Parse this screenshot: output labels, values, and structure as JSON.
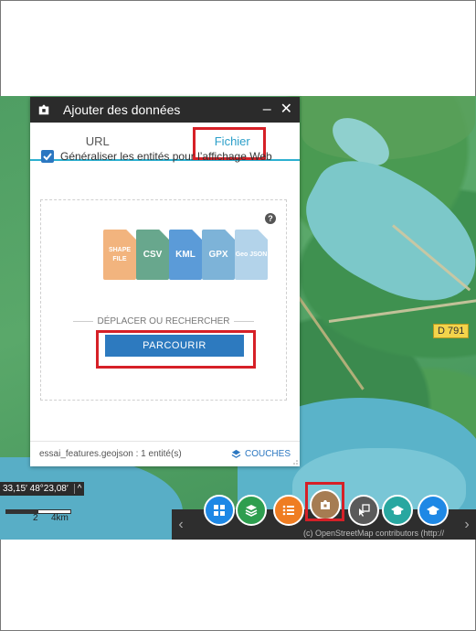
{
  "dialog": {
    "title": "Ajouter des données",
    "minimize_label": "–",
    "close_label": "✕",
    "tabs": [
      {
        "label": "URL",
        "active": false
      },
      {
        "label": "Fichier",
        "active": true
      }
    ],
    "generalize_checkbox": {
      "label": "Généraliser les entités pour l’affichage Web",
      "checked": true
    },
    "help_label": "?",
    "file_types": [
      "SHAPE FILE",
      "CSV",
      "KML",
      "GPX",
      "Geo JSON"
    ],
    "drop_hint": "DÉPLACER OU RECHERCHER",
    "browse_label": "PARCOURIR",
    "status": "essai_features.geojson : 1 entité(s)",
    "layers_label": "COUCHES"
  },
  "map": {
    "road_label": "D 791",
    "coords": "33,15′ 48°23,08′",
    "scale_labels": [
      "2",
      "4km"
    ],
    "attribution": "(c) OpenStreetMap contributors (http://"
  },
  "toolbar": {
    "tools": [
      {
        "name": "basemap-gallery",
        "icon": "grid-icon",
        "color": "#1e88e5"
      },
      {
        "name": "layer-list",
        "icon": "layers-icon",
        "color": "#2e9e4f"
      },
      {
        "name": "legend",
        "icon": "list-icon",
        "color": "#ef7d22"
      },
      {
        "name": "add-data",
        "icon": "add-data-icon",
        "color": "#a67c52",
        "highlighted": true
      },
      {
        "name": "select",
        "icon": "select-icon",
        "color": "#5a5a5a"
      },
      {
        "name": "measurement",
        "icon": "hat-icon",
        "color": "#28a7a0"
      },
      {
        "name": "about",
        "icon": "hat-icon",
        "color": "#1e88e5"
      }
    ]
  },
  "colors": {
    "accent": "#2b9fc9",
    "highlight": "#d62027",
    "button": "#2d7abf"
  }
}
